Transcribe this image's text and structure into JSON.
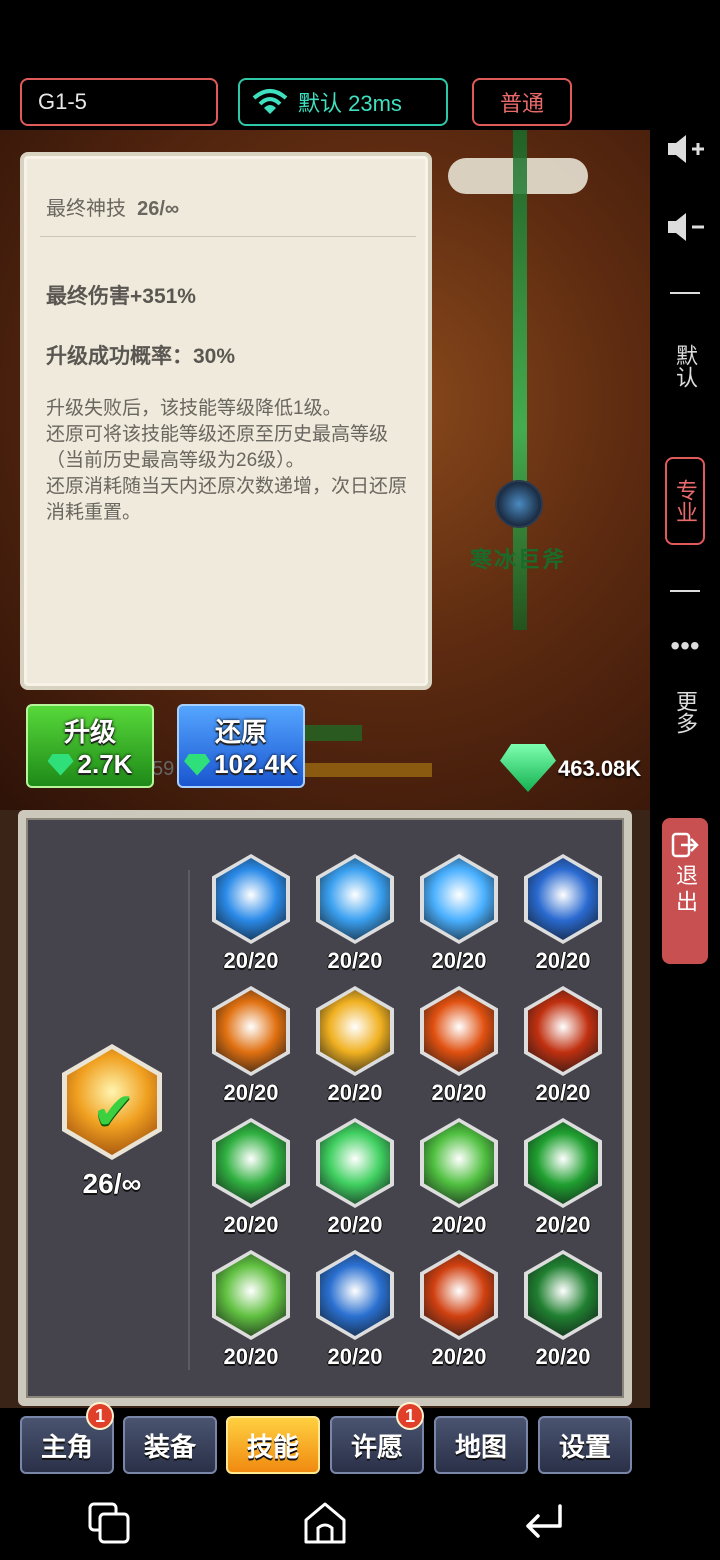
{
  "topbar": {
    "stage": "G1-5",
    "network": "默认 23ms",
    "mode": "普通"
  },
  "scene": {
    "enemy_name": "寒冰巨斧",
    "partial_number": "59",
    "gems": "463.08K"
  },
  "tooltip": {
    "skill_name": "最终神技",
    "skill_level": "26/∞",
    "effect": "最终伤害+351%",
    "success_rate": "升级成功概率：30%",
    "desc_lines": [
      "升级失败后，该技能等级降低1级。",
      "还原可将该技能等级还原至历史最高等级（当前历史最高等级为26级）。",
      "还原消耗随当天内还原次数递增，次日还原消耗重置。"
    ]
  },
  "actions": {
    "upgrade_label": "升级",
    "upgrade_cost": "2.7K",
    "restore_label": "还原",
    "restore_cost": "102.4K"
  },
  "side": {
    "default": "默认",
    "pro": "专业",
    "more": "更多",
    "exit": "退出"
  },
  "skills": {
    "selected_level": "26/∞",
    "grid": [
      {
        "level": "20/20",
        "icon": "ice-burst-icon",
        "color": "#2a8ae8"
      },
      {
        "level": "20/20",
        "icon": "ice-tornado-icon",
        "color": "#3aa0f0"
      },
      {
        "level": "20/20",
        "icon": "ice-wave-icon",
        "color": "#4ab0ff"
      },
      {
        "level": "20/20",
        "icon": "ice-shard-icon",
        "color": "#2a6ad0"
      },
      {
        "level": "20/20",
        "icon": "fire-pillar-icon",
        "color": "#e07010"
      },
      {
        "level": "20/20",
        "icon": "fire-orb-icon",
        "color": "#f0b020"
      },
      {
        "level": "20/20",
        "icon": "fire-blast-icon",
        "color": "#e05010"
      },
      {
        "level": "20/20",
        "icon": "fire-ring-icon",
        "color": "#c03010"
      },
      {
        "level": "20/20",
        "icon": "wind-arrow-icon",
        "color": "#30b040"
      },
      {
        "level": "20/20",
        "icon": "lightning-green-icon",
        "color": "#40d060"
      },
      {
        "level": "20/20",
        "icon": "wind-vortex-icon",
        "color": "#50c040"
      },
      {
        "level": "20/20",
        "icon": "pentagram-icon",
        "color": "#20a030"
      },
      {
        "level": "20/20",
        "icon": "heal-heart-icon",
        "color": "#60c040"
      },
      {
        "level": "20/20",
        "icon": "water-swirl-icon",
        "color": "#2a70d0"
      },
      {
        "level": "20/20",
        "icon": "inferno-icon",
        "color": "#d04010"
      },
      {
        "level": "20/20",
        "icon": "thorn-vine-icon",
        "color": "#208030"
      }
    ]
  },
  "tabs": [
    {
      "label": "主角",
      "badge": "1"
    },
    {
      "label": "装备",
      "badge": ""
    },
    {
      "label": "技能",
      "badge": ""
    },
    {
      "label": "许愿",
      "badge": "1"
    },
    {
      "label": "地图",
      "badge": ""
    },
    {
      "label": "设置",
      "badge": ""
    }
  ]
}
